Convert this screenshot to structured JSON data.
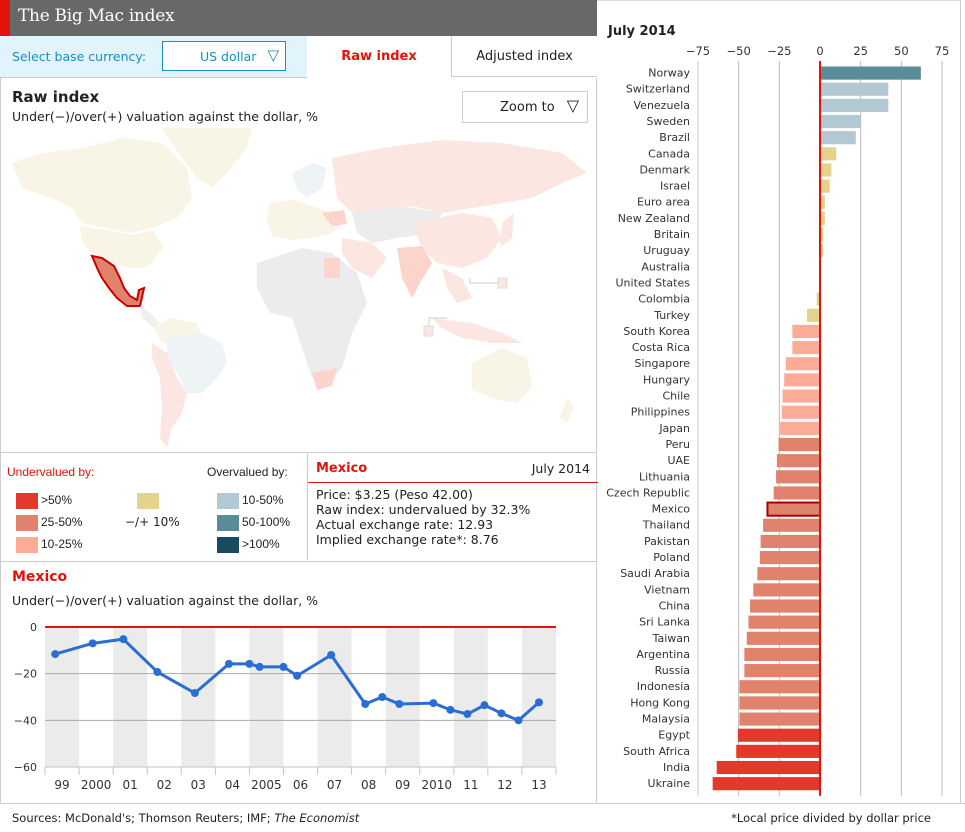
{
  "header": {
    "title": "The Big Mac index"
  },
  "controls": {
    "base_currency_label": "Select base currency:",
    "base_currency_value": "US dollar",
    "tabs": [
      {
        "label": "Raw index",
        "active": true
      },
      {
        "label": "Adjusted index",
        "active": false
      }
    ]
  },
  "map_section": {
    "title": "Raw index",
    "subtitle": "Under(−)/over(+) valuation against the dollar, %",
    "zoom_label": "Zoom to",
    "highlighted_country": "Mexico"
  },
  "legend": {
    "undervalued_label": "Undervalued by:",
    "overvalued_label": "Overvalued by:",
    "under_items": [
      {
        "label": ">50%",
        "color": "#e3392c"
      },
      {
        "label": "25-50%",
        "color": "#e0826c"
      },
      {
        "label": "10-25%",
        "color": "#fcac96"
      }
    ],
    "neutral_item": {
      "label": "−/+ 10%",
      "color": "#e3d38c"
    },
    "over_items": [
      {
        "label": "10-50%",
        "color": "#b2c8d3"
      },
      {
        "label": "50-100%",
        "color": "#5a8c99"
      },
      {
        "label": ">100%",
        "color": "#1c4a60"
      }
    ]
  },
  "info_box": {
    "country": "Mexico",
    "date": "July 2014",
    "lines": [
      "Price: $3.25 (Peso 42.00)",
      "Raw index: undervalued by 32.3%",
      "Actual exchange rate: 12.93",
      "Implied exchange rate*: 8.76"
    ]
  },
  "history_section": {
    "title": "Mexico",
    "subtitle": "Under(−)/over(+) valuation against the dollar, %"
  },
  "footer": {
    "sources_prefix": "Sources: McDonald's; Thomson Reuters; IMF; ",
    "sources_italic": "The Economist",
    "note": "*Local price divided by dollar price"
  },
  "right_panel": {
    "title": "July 2014"
  },
  "chart_data": [
    {
      "type": "line",
      "title": "Mexico",
      "ylabel": "Under(−)/over(+) valuation against the dollar, %",
      "x_tick_labels": [
        "99",
        "2000",
        "01",
        "02",
        "03",
        "04",
        "2005",
        "06",
        "07",
        "08",
        "09",
        "2010",
        "11",
        "12",
        "13"
      ],
      "y_ticks": [
        0,
        -20,
        -40,
        -60
      ],
      "ylim": [
        -60,
        0
      ],
      "xlim": [
        1999,
        2014
      ],
      "grid": true,
      "reference_line": 0,
      "series": [
        {
          "name": "Mexico raw index",
          "color": "#2a6ed1",
          "x": [
            1999.3,
            2000.4,
            2001.3,
            2002.3,
            2003.4,
            2004.4,
            2005.0,
            2005.3,
            2006.0,
            2006.4,
            2007.4,
            2008.4,
            2008.9,
            2009.4,
            2010.4,
            2010.9,
            2011.4,
            2011.9,
            2012.4,
            2012.9,
            2013.5
          ],
          "values": [
            -11.6,
            -7.0,
            -5.2,
            -19.3,
            -28.3,
            -15.8,
            -15.8,
            -17.1,
            -17.1,
            -20.9,
            -12.0,
            -33.0,
            -30.0,
            -33.0,
            -32.6,
            -35.5,
            -37.3,
            -33.5,
            -37.0,
            -40.0,
            -32.3
          ]
        }
      ]
    },
    {
      "type": "bar",
      "orientation": "horizontal",
      "title": "July 2014",
      "xlim": [
        -75,
        75
      ],
      "x_ticks": [
        -75,
        -50,
        -25,
        0,
        25,
        50,
        75
      ],
      "grid": true,
      "reference_line": 0,
      "highlighted": "Mexico",
      "categories": [
        "Norway",
        "Switzerland",
        "Venezuela",
        "Sweden",
        "Brazil",
        "Canada",
        "Denmark",
        "Israel",
        "Euro area",
        "New Zealand",
        "Britain",
        "Uruguay",
        "Australia",
        "United States",
        "Colombia",
        "Turkey",
        "South Korea",
        "Costa Rica",
        "Singapore",
        "Hungary",
        "Chile",
        "Philippines",
        "Japan",
        "Peru",
        "UAE",
        "Lithuania",
        "Czech Republic",
        "Mexico",
        "Thailand",
        "Pakistan",
        "Poland",
        "Saudi Arabia",
        "Vietnam",
        "China",
        "Sri Lanka",
        "Taiwan",
        "Argentina",
        "Russia",
        "Indonesia",
        "Hong Kong",
        "Malaysia",
        "Egypt",
        "South Africa",
        "India",
        "Ukraine"
      ],
      "values": [
        62,
        42,
        42,
        25,
        22,
        10,
        7,
        6,
        3,
        3,
        2,
        2,
        0,
        0,
        -2,
        -8,
        -17,
        -17,
        -21,
        -22,
        -23,
        -23.5,
        -24.5,
        -25.5,
        -26.5,
        -27,
        -28.5,
        -32.3,
        -35,
        -36.5,
        -37,
        -38.5,
        -41,
        -43,
        -44,
        -45,
        -46.5,
        -46.5,
        -49.5,
        -49.5,
        -49.5,
        -50.5,
        -51.5,
        -63.5,
        -66
      ]
    }
  ]
}
